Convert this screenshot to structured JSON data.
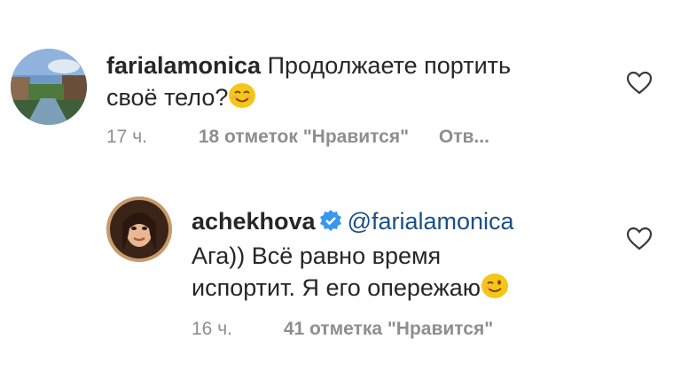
{
  "comments": [
    {
      "username": "farialamonica",
      "text_line1": "Продолжаете портить",
      "text_line2": "своё тело?",
      "emoji": "smiling-face-emoji",
      "time": "17 ч.",
      "likes": "18 отметок \"Нравится\"",
      "reply": "Отв..."
    },
    {
      "username": "achekhova",
      "mention": "@farialamonica",
      "text_line1": "Ага)) Всё равно время",
      "text_line2": "испортит. Я его опережаю",
      "emoji": "winking-face-emoji",
      "time": "16 ч.",
      "likes": "41 отметка \"Нравится\""
    }
  ],
  "icons": {
    "like": "heart-outline-icon",
    "verified": "verified-badge-icon"
  },
  "colors": {
    "verified": "#3897f0",
    "mention": "#1a4f86",
    "emoji": "#f5c518"
  }
}
